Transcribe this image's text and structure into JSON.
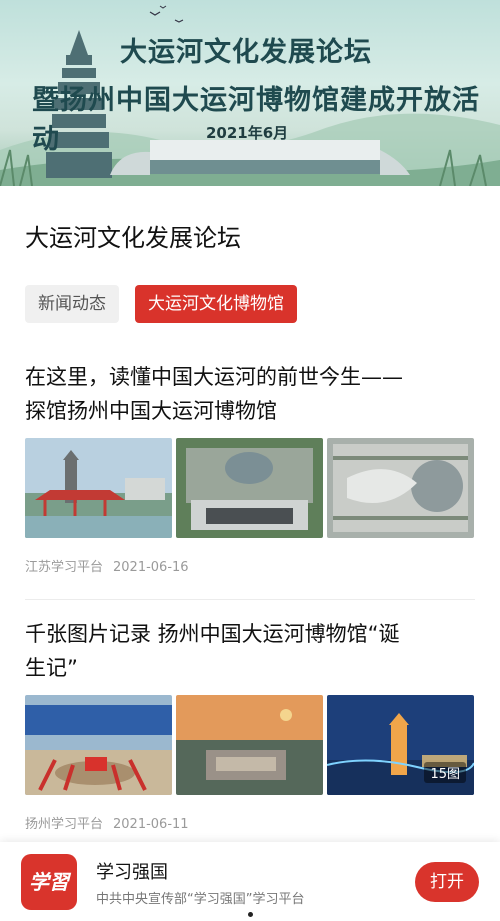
{
  "banner": {
    "title_line1": "大运河文化发展论坛",
    "title_line2": "暨扬州中国大运河博物馆建成开放活动",
    "date": "2021年6月"
  },
  "page_title": "大运河文化发展论坛",
  "tabs": [
    {
      "label": "新闻动态",
      "active": false
    },
    {
      "label": "大运河文化博物馆",
      "active": true
    }
  ],
  "articles": [
    {
      "title_line1": "在这里，读懂中国大运河的前世今生——",
      "title_line2": "探馆扬州中国大运河博物馆",
      "source": "江苏学习平台",
      "date": "2021-06-16"
    },
    {
      "title_line1": "千张图片记录 扬州中国大运河博物馆“诞",
      "title_line2": "生记”",
      "source": "扬州学习平台",
      "date": "2021-06-11",
      "image_count": "15图"
    }
  ],
  "app_bar": {
    "logo_text": "学習",
    "name": "学习强国",
    "description": "中共中央宣传部“学习强国”学习平台",
    "open_label": "打开"
  },
  "colors": {
    "accent": "#d9332b",
    "banner_title": "#1f4a4f"
  }
}
